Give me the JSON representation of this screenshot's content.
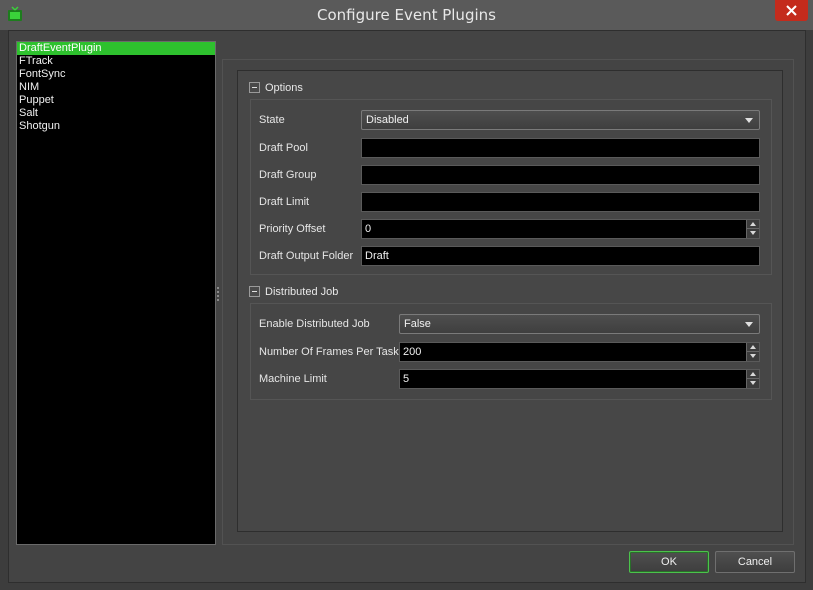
{
  "window": {
    "title": "Configure Event Plugins",
    "icon": "tv-app-icon",
    "accent_color": "#2ec12e",
    "close_color": "#c42b1c"
  },
  "plugins": {
    "selected_index": 0,
    "items": [
      {
        "label": "DraftEventPlugin"
      },
      {
        "label": "FTrack"
      },
      {
        "label": "FontSync"
      },
      {
        "label": "NIM"
      },
      {
        "label": "Puppet"
      },
      {
        "label": "Salt"
      },
      {
        "label": "Shotgun"
      }
    ]
  },
  "options": {
    "title": "Options",
    "state_label": "State",
    "state_value": "Disabled",
    "draft_pool_label": "Draft Pool",
    "draft_pool_value": "",
    "draft_group_label": "Draft Group",
    "draft_group_value": "",
    "draft_limit_label": "Draft Limit",
    "draft_limit_value": "",
    "priority_offset_label": "Priority Offset",
    "priority_offset_value": "0",
    "output_folder_label": "Draft Output Folder",
    "output_folder_value": "Draft"
  },
  "distributed": {
    "title": "Distributed Job",
    "enable_label": "Enable Distributed Job",
    "enable_value": "False",
    "frames_label": "Number Of Frames Per Task",
    "frames_value": "200",
    "machine_limit_label": "Machine Limit",
    "machine_limit_value": "5"
  },
  "buttons": {
    "ok": "OK",
    "cancel": "Cancel"
  }
}
